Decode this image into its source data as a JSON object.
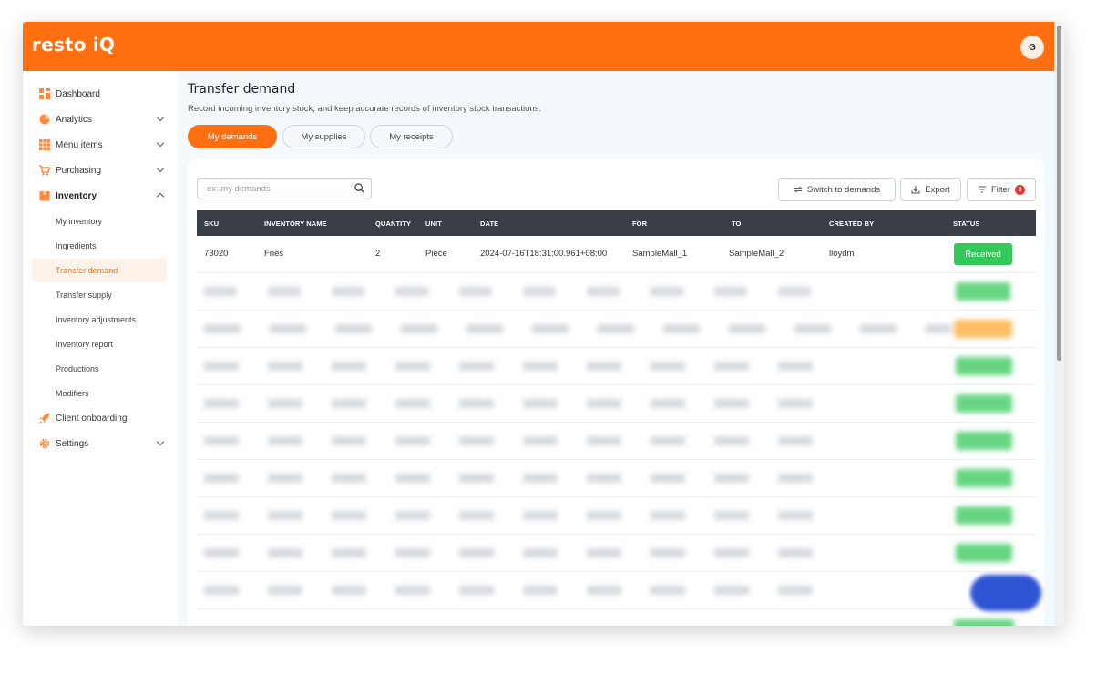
{
  "app": {
    "logo": "resto iQ",
    "avatar_initial": "G",
    "brand_color": "#ff6f12"
  },
  "sidebar": {
    "items": [
      {
        "label": "Dashboard",
        "icon": "dashboard-grid-icon",
        "chevron": false
      },
      {
        "label": "Analytics",
        "icon": "pie-chart-icon",
        "chevron": true
      },
      {
        "label": "Menu items",
        "icon": "menu-grid-icon",
        "chevron": true
      },
      {
        "label": "Purchasing",
        "icon": "cart-icon",
        "chevron": true
      },
      {
        "label": "Inventory",
        "icon": "box-icon",
        "chevron": true,
        "expanded": true
      }
    ],
    "inventory_sub": [
      {
        "label": "My inventory"
      },
      {
        "label": "Ingredients"
      },
      {
        "label": "Transfer demand",
        "active": true
      },
      {
        "label": "Transfer supply"
      },
      {
        "label": "Inventory adjustments"
      },
      {
        "label": "Inventory report"
      },
      {
        "label": "Productions"
      },
      {
        "label": "Modifiers"
      }
    ],
    "bottom_items": [
      {
        "label": "Client onboarding",
        "icon": "rocket-icon"
      },
      {
        "label": "Settings",
        "icon": "gear-icon",
        "chevron": true
      }
    ]
  },
  "page": {
    "title": "Transfer demand",
    "subtitle": "Record incoming inventory stock, and keep accurate records of inventory stock transactions.",
    "tabs": [
      {
        "label": "My demands",
        "active": true
      },
      {
        "label": "My supplies"
      },
      {
        "label": "My receipts"
      }
    ]
  },
  "toolbar": {
    "search_placeholder": "ex: my demands",
    "switch_label": "Switch to demands",
    "export_label": "Export",
    "filter_label": "Filter",
    "filter_count": "0"
  },
  "table": {
    "columns": [
      "SKU",
      "INVENTORY NAME",
      "QUANTITY",
      "UNIT",
      "DATE",
      "FOR",
      "TO",
      "CREATED BY",
      "STATUS"
    ],
    "rows": [
      {
        "sku": "73020",
        "name": "Fries",
        "qty": "2",
        "unit": "Piece",
        "date": "2024-07-16T18:31:00.961+08:00",
        "for": "SampleMall_1",
        "to": "SampleMall_2",
        "by": "lloydm",
        "status": "Received"
      }
    ]
  }
}
